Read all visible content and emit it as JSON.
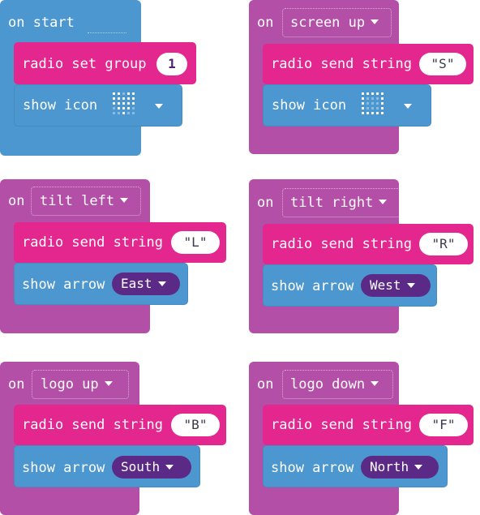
{
  "colors": {
    "basic": "#4c97d0",
    "radio": "#e3278e",
    "input": "#b44fa8",
    "arrow_pill": "#5b2a86"
  },
  "block1": {
    "event_label": "on start",
    "radio_label": "radio set group",
    "group_value": "1",
    "show_label": "show icon",
    "icon": "heart-icon"
  },
  "block2": {
    "event_label": "on",
    "gesture": "screen up",
    "radio_label": "radio send string",
    "string_value": "\"S\"",
    "show_label": "show icon",
    "icon": "square-outline-icon"
  },
  "block3": {
    "event_label": "on",
    "gesture": "tilt left",
    "radio_label": "radio send string",
    "string_value": "\"L\"",
    "show_label": "show arrow",
    "arrow": "East"
  },
  "block4": {
    "event_label": "on",
    "gesture": "tilt right",
    "radio_label": "radio send string",
    "string_value": "\"R\"",
    "show_label": "show arrow",
    "arrow": "West"
  },
  "block5": {
    "event_label": "on",
    "gesture": "logo up",
    "radio_label": "radio send string",
    "string_value": "\"B\"",
    "show_label": "show arrow",
    "arrow": "South"
  },
  "block6": {
    "event_label": "on",
    "gesture": "logo down",
    "radio_label": "radio send string",
    "string_value": "\"F\"",
    "show_label": "show arrow",
    "arrow": "North"
  }
}
